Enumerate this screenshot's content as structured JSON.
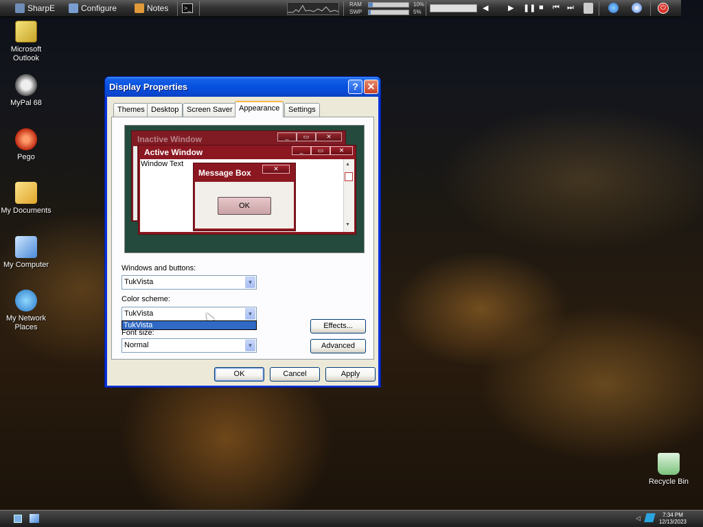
{
  "topbar": {
    "items": [
      {
        "label": "SharpE"
      },
      {
        "label": "Configure"
      },
      {
        "label": "Notes"
      }
    ],
    "ram_label": "RAM",
    "swp_label": "SWP",
    "ram_pct": "10%",
    "swp_pct": "5%",
    "ram_fraction": 0.1,
    "swp_fraction": 0.05
  },
  "desktop_icons": [
    {
      "label": "Microsoft Outlook"
    },
    {
      "label": "MyPal 68"
    },
    {
      "label": "Pego"
    },
    {
      "label": "My Documents"
    },
    {
      "label": "My Computer"
    },
    {
      "label": "My Network Places"
    },
    {
      "label": "Recycle Bin"
    }
  ],
  "dialog": {
    "title": "Display Properties",
    "help_glyph": "?",
    "close_glyph": "✕",
    "tabs": [
      {
        "label": "Themes"
      },
      {
        "label": "Desktop"
      },
      {
        "label": "Screen Saver"
      },
      {
        "label": "Appearance",
        "active": true
      },
      {
        "label": "Settings"
      }
    ],
    "preview": {
      "inactive_title": "Inactive Window",
      "active_title": "Active Window",
      "window_text": "Window Text",
      "message_title": "Message Box",
      "ok_label": "OK",
      "inactive_title_color": "#c98a90",
      "active_title_color": "#ffffff"
    },
    "windows_buttons_label": "Windows and buttons:",
    "windows_buttons_value": "TukVista",
    "color_scheme_label": "Color scheme:",
    "color_scheme_value": "TukVista",
    "color_scheme_dropdown_option": "TukVista",
    "font_size_label": "Font size:",
    "font_size_value": "Normal",
    "effects_button": "Effects...",
    "advanced_button": "Advanced",
    "ok_button": "OK",
    "cancel_button": "Cancel",
    "apply_button": "Apply"
  },
  "taskbar": {
    "time": "7:34 PM",
    "date": "12/13/2023"
  },
  "colors": {
    "xp_blue": "#0550de",
    "dialog_face": "#ece9d8",
    "preview_bg": "#234a3c",
    "window_red": "#8b1721",
    "selection": "#316ac5"
  }
}
